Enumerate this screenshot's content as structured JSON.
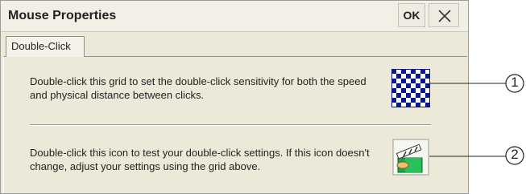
{
  "window": {
    "title": "Mouse Properties",
    "ok_label": "OK"
  },
  "tabs": [
    {
      "label": "Double-Click"
    }
  ],
  "panel": {
    "grid_description": "Double-click this grid to set the double-click sensitivity for both the speed and physical distance between clicks.",
    "test_description": "Double-click this icon to test your double-click settings. If this icon doesn't change, adjust your settings using the grid above."
  },
  "icons": {
    "grid": "checkerboard-grid-icon",
    "test": "clapperboard-test-icon",
    "close": "close-icon"
  },
  "callouts": [
    "1",
    "2"
  ],
  "colors": {
    "dialog_bg": "#ece9d8",
    "grid_blue": "#0a1a8c",
    "test_green": "#1aa34a"
  }
}
